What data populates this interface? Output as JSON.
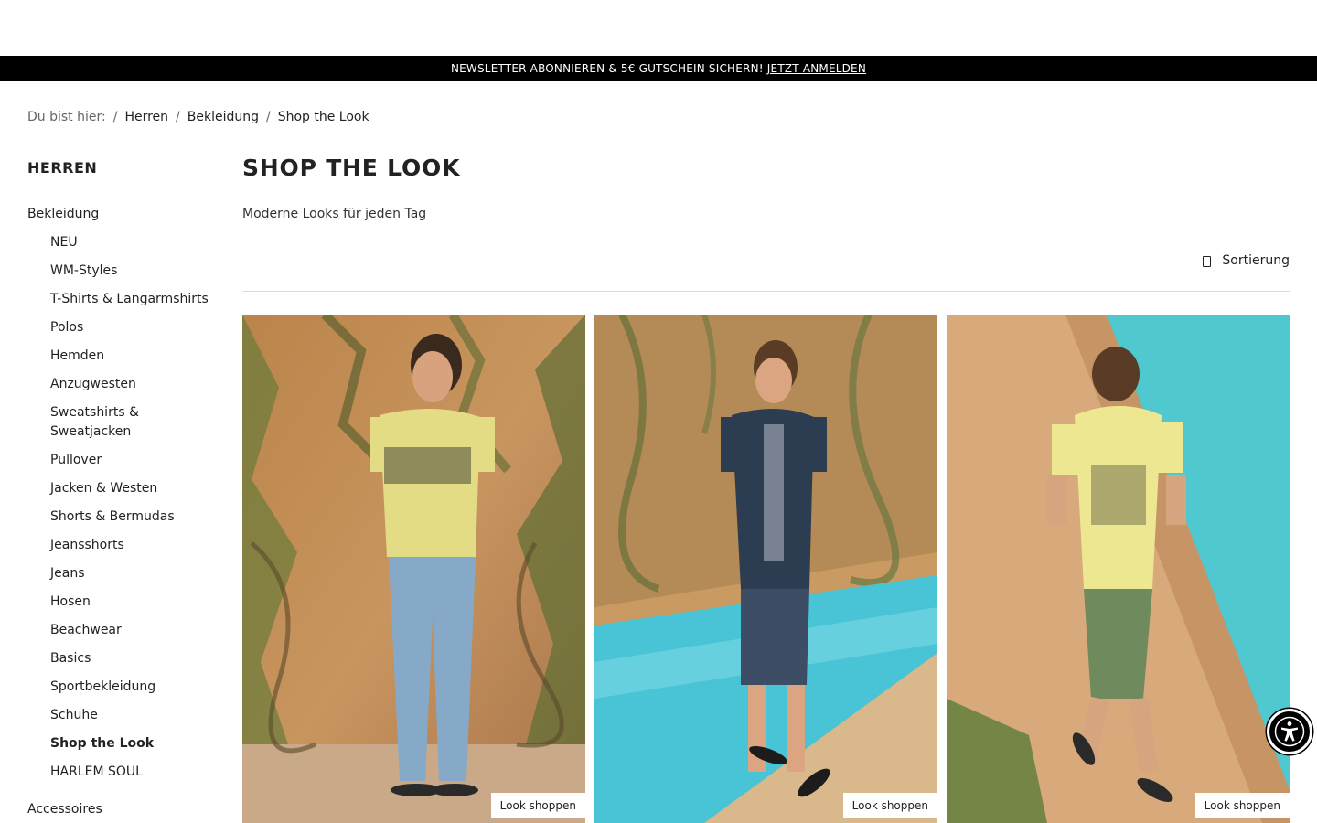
{
  "promo": {
    "text": "NEWSLETTER ABONNIEREN & 5€ GUTSCHEIN SICHERN!",
    "link": "JETZT ANMELDEN"
  },
  "breadcrumb": {
    "prefix": "Du bist hier:",
    "items": [
      "Herren",
      "Bekleidung",
      "Shop the Look"
    ]
  },
  "sidebar": {
    "title": "HERREN",
    "category": "Bekleidung",
    "items": [
      "NEU",
      "WM-Styles",
      "T-Shirts & Langarmshirts",
      "Polos",
      "Hemden",
      "Anzugwesten",
      "Sweatshirts & Sweatjacken",
      "Pullover",
      "Jacken & Westen",
      "Shorts & Bermudas",
      "Jeansshorts",
      "Jeans",
      "Hosen",
      "Beachwear",
      "Basics",
      "Sportbekleidung",
      "Schuhe",
      "Shop the Look",
      "HARLEM SOUL"
    ],
    "active_item": "Shop the Look",
    "next_category": "Accessoires"
  },
  "main": {
    "title": "SHOP THE LOOK",
    "subtitle": "Moderne Looks für jeden Tag",
    "sort_label": "Sortierung"
  },
  "looks": [
    {
      "button": "Look shoppen"
    },
    {
      "button": "Look shoppen"
    },
    {
      "button": "Look shoppen"
    }
  ],
  "colors": {
    "promo_bg": "#000000",
    "text": "#222222",
    "divider": "#dddddd"
  },
  "icons": {
    "sort": "sort-icon",
    "accessibility": "accessibility-icon"
  }
}
